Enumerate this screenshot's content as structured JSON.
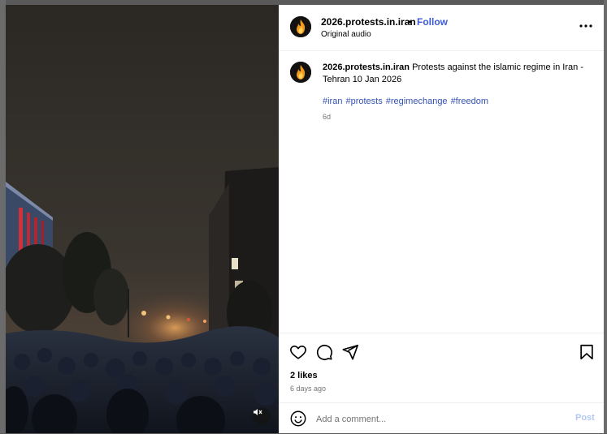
{
  "post": {
    "username": "2026.protests.in.iran",
    "follow_label": "Follow",
    "separator": "•",
    "audio_label": "Original audio",
    "caption_text": "Protests against the islamic regime in Iran - Tehran 10 Jan 2026",
    "hashtags": [
      "#iran",
      "#protests",
      "#regimechange",
      "#freedom"
    ],
    "caption_age": "6d",
    "likes": "2 likes",
    "posted_ago": "6 days ago"
  },
  "comment": {
    "placeholder": "Add a comment...",
    "post_label": "Post"
  },
  "icons": {
    "more": "more-options-icon",
    "like": "heart-icon",
    "comment": "comment-bubble-icon",
    "share": "paper-plane-icon",
    "save": "bookmark-icon",
    "emoji": "emoji-face-icon",
    "mute": "speaker-muted-icon"
  },
  "colors": {
    "link_blue": "#3451b2",
    "follow_blue": "#3b5bdb",
    "muted_text": "#737373",
    "post_disabled": "#b3c7f4"
  }
}
